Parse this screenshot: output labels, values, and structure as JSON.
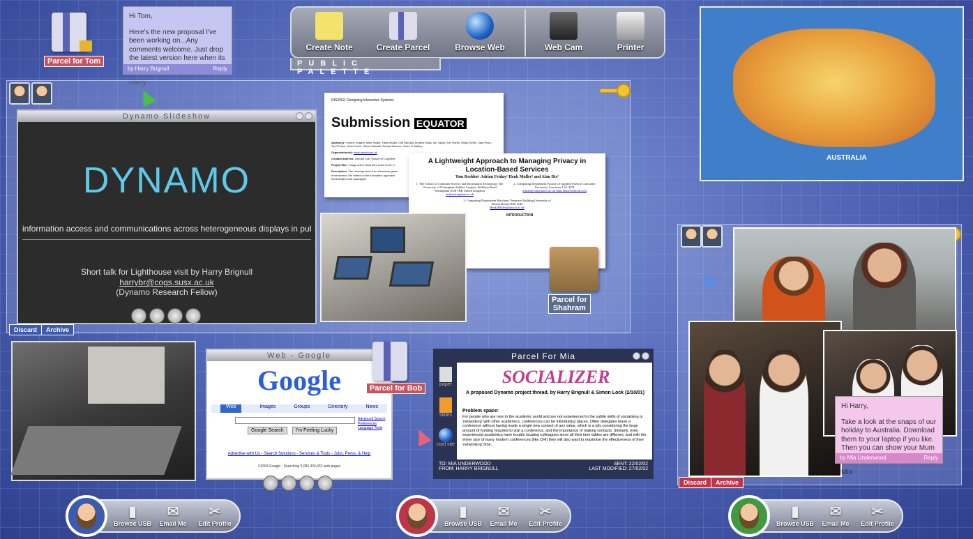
{
  "palette": {
    "title": "PUBLIC PALETTE",
    "items": [
      {
        "label": "Create Note",
        "icon": "sticky-notes-icon"
      },
      {
        "label": "Create Parcel",
        "icon": "parcel-icon"
      },
      {
        "label": "Browse Web",
        "icon": "globe-icon"
      },
      {
        "label": "Web Cam",
        "icon": "webcam-icon"
      },
      {
        "label": "Printer",
        "icon": "printer-icon"
      }
    ]
  },
  "parcels": {
    "tom": "Parcel for Tom",
    "shahram_line1": "Parcel for",
    "shahram_line2": "Shahram",
    "bob": "Parcel for Bob"
  },
  "note_tom": {
    "greeting": "Hi Tom,",
    "body": "Here's the new proposal I've been working on...Any comments welcome. Just drop the latest version here when its done. Ta",
    "sign": "Harry",
    "footer": "by Harry Brignull",
    "reply": "Reply"
  },
  "note_harry": {
    "greeting": "Hi Harry,",
    "body": "Take a look at the snaps of our holiday to Australia. Download them to your laptop if you like. Then you can show your Mum and Dad. See you tonight.",
    "sign": "Mia",
    "footer": "by Mia Underwood",
    "reply": "Reply"
  },
  "slideshow": {
    "title": "Dynamo Slideshow",
    "logo": "DYNAMO",
    "tagline": "information access and communications across heterogeneous displays in public spaces",
    "talk": "Short talk for Lighthouse visit by Harry Brignull",
    "email": "harrybr@cogs.susx.ac.uk",
    "role": "(Dynamo Research Fellow)"
  },
  "panel_actions": {
    "discard": "Discard",
    "archive": "Archive"
  },
  "submission_doc": {
    "header": "DIS2002: Designing Interactive Systems",
    "title": "Submission",
    "brand": "EQUATOR",
    "authors_label": "Author(s):",
    "authors": "Yvonne Rogers, Mike Scaife, Henk Muller, Cliff Randell, Andrew Moss, Ian Taylor, Eric Harris, Hilary Smith, Sara Price, Ted Phelps, Grest Corke, Silvia Gabrielli, Danae Stanton, Claire O' Malley",
    "org_label": "Organisation(s):",
    "org": "www.equator.ac.uk",
    "contact_label": "Contact address:",
    "contact": "Interact Lab, School of Cognitive",
    "project_label": "Project title:",
    "project": "Things aren't what they seem to be: in",
    "desc_label": "Description:",
    "desc": "The development of an adventure game environment. We reflect on the innovative approach technologies and paradigms."
  },
  "privacy_paper": {
    "title": "A Lightweight Approach to Managing Privacy in Location-Based Services",
    "authors": "Tom Rodden¹ Adrian Friday² Henk Muller³ and Alan Dix²",
    "affil1": "1. The School of Computer Science and Information Technology The University of Nottingham Jubilee Campus, Wollaton Road Nottingham NG8 1BB United Kingdom",
    "affil1_email": "tar@nottingham.ac.uk",
    "affil2": "2. Computing Department Faculty of Applied Sciences Lancaster University Lancaster LA1 4YR",
    "affil2_email": "adrian@comp.lancs.ac.uk Alan.Dix@hcibook.com",
    "affil3": "3. Computing Department Merchant Venturers Building University of Bristol Bristol BS8 1UB",
    "affil3_email": "Henk.Muller@bristol.ac.uk",
    "intro": "INTRODUCTION"
  },
  "google": {
    "window_title": "Web - Google",
    "logo": "Google",
    "tabs": [
      "Web",
      "Images",
      "Groups",
      "Directory",
      "News"
    ],
    "search_button": "Google Search",
    "lucky_button": "I'm Feeling Lucky",
    "side_links": [
      "Advanced Search",
      "Preferences",
      "Language Tools"
    ],
    "footer_links": "Advertise with Us - Search Solutions - Services & Tools - Jobs, Press, & Help",
    "copyright": "©2003 Google - Searching 3,083,324,652 web pages"
  },
  "parcel_mia": {
    "title": "Parcel For Mia",
    "side_items": [
      {
        "label": "paper",
        "icon": "paper-icon"
      },
      {
        "label": "slides",
        "icon": "slides-icon"
      },
      {
        "label": "cool site",
        "icon": "globe-icon"
      }
    ],
    "logo": "SOCIALIZER",
    "subtitle": "A proposed Dynamo project thread, by Harry Brignull & Simon Lock (2/10/01)",
    "problem_label": "Problem space:",
    "problem": "For people who are new to the academic world and are not experienced in the subtle skills of socialising or 'networking' with other academics, conferences can be intimidating places. Often delegates leave a conference without having made a single new contact of any value, which is a pity considering the large amount of funding required to visit a conference, and the importance of making contacts. Similarly, even experienced academics have trouble locating colleagues since all their time-tables are different, and with the sheer size of many modern conferences (like CHI) they will also want to maximise the effectiveness of their 'networking' time.",
    "to": "TO: MIA UNDERWOOD",
    "from": "FROM: HARRY BRIGNULL",
    "sent": "SENT: 22/02/02",
    "modified": "LAST MODIFIED: 27/02/02"
  },
  "map": {
    "label": "AUSTRALIA"
  },
  "docks": [
    {
      "items": [
        "Browse USB",
        "Email Me",
        "Edit Profile"
      ]
    },
    {
      "items": [
        "Browse USB",
        "Email Me",
        "Edit Profile"
      ]
    },
    {
      "items": [
        "Browse USB",
        "Email Me",
        "Edit Profile"
      ]
    }
  ],
  "colors": {
    "accent": "#c8535f",
    "palette": "#7b8094",
    "background": "#4d63b4"
  }
}
